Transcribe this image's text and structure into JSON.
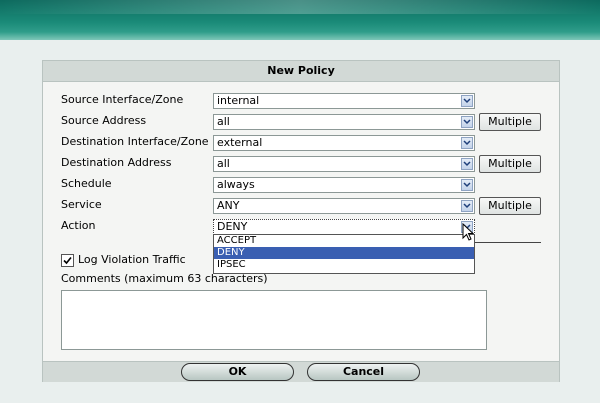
{
  "title": "New Policy",
  "fields": [
    {
      "label": "Source Interface/Zone",
      "value": "internal"
    },
    {
      "label": "Source Address",
      "value": "all",
      "button": "Multiple"
    },
    {
      "label": "Destination Interface/Zone",
      "value": "external"
    },
    {
      "label": "Destination Address",
      "value": "all",
      "button": "Multiple"
    },
    {
      "label": "Schedule",
      "value": "always"
    },
    {
      "label": "Service",
      "value": "ANY",
      "button": "Multiple"
    }
  ],
  "action": {
    "label": "Action",
    "value": "DENY",
    "options": [
      "ACCEPT",
      "DENY",
      "IPSEC"
    ],
    "selected_index": 1
  },
  "log_violation": {
    "label": "Log Violation Traffic",
    "checked": true
  },
  "comments": {
    "label": "Comments (maximum 63 characters)",
    "value": ""
  },
  "buttons": {
    "ok": "OK",
    "cancel": "Cancel"
  },
  "colors": {
    "banner": "#1a8a78",
    "selection": "#3a5fb2",
    "panel": "#f4f5f3",
    "header": "#d2d9d6"
  }
}
